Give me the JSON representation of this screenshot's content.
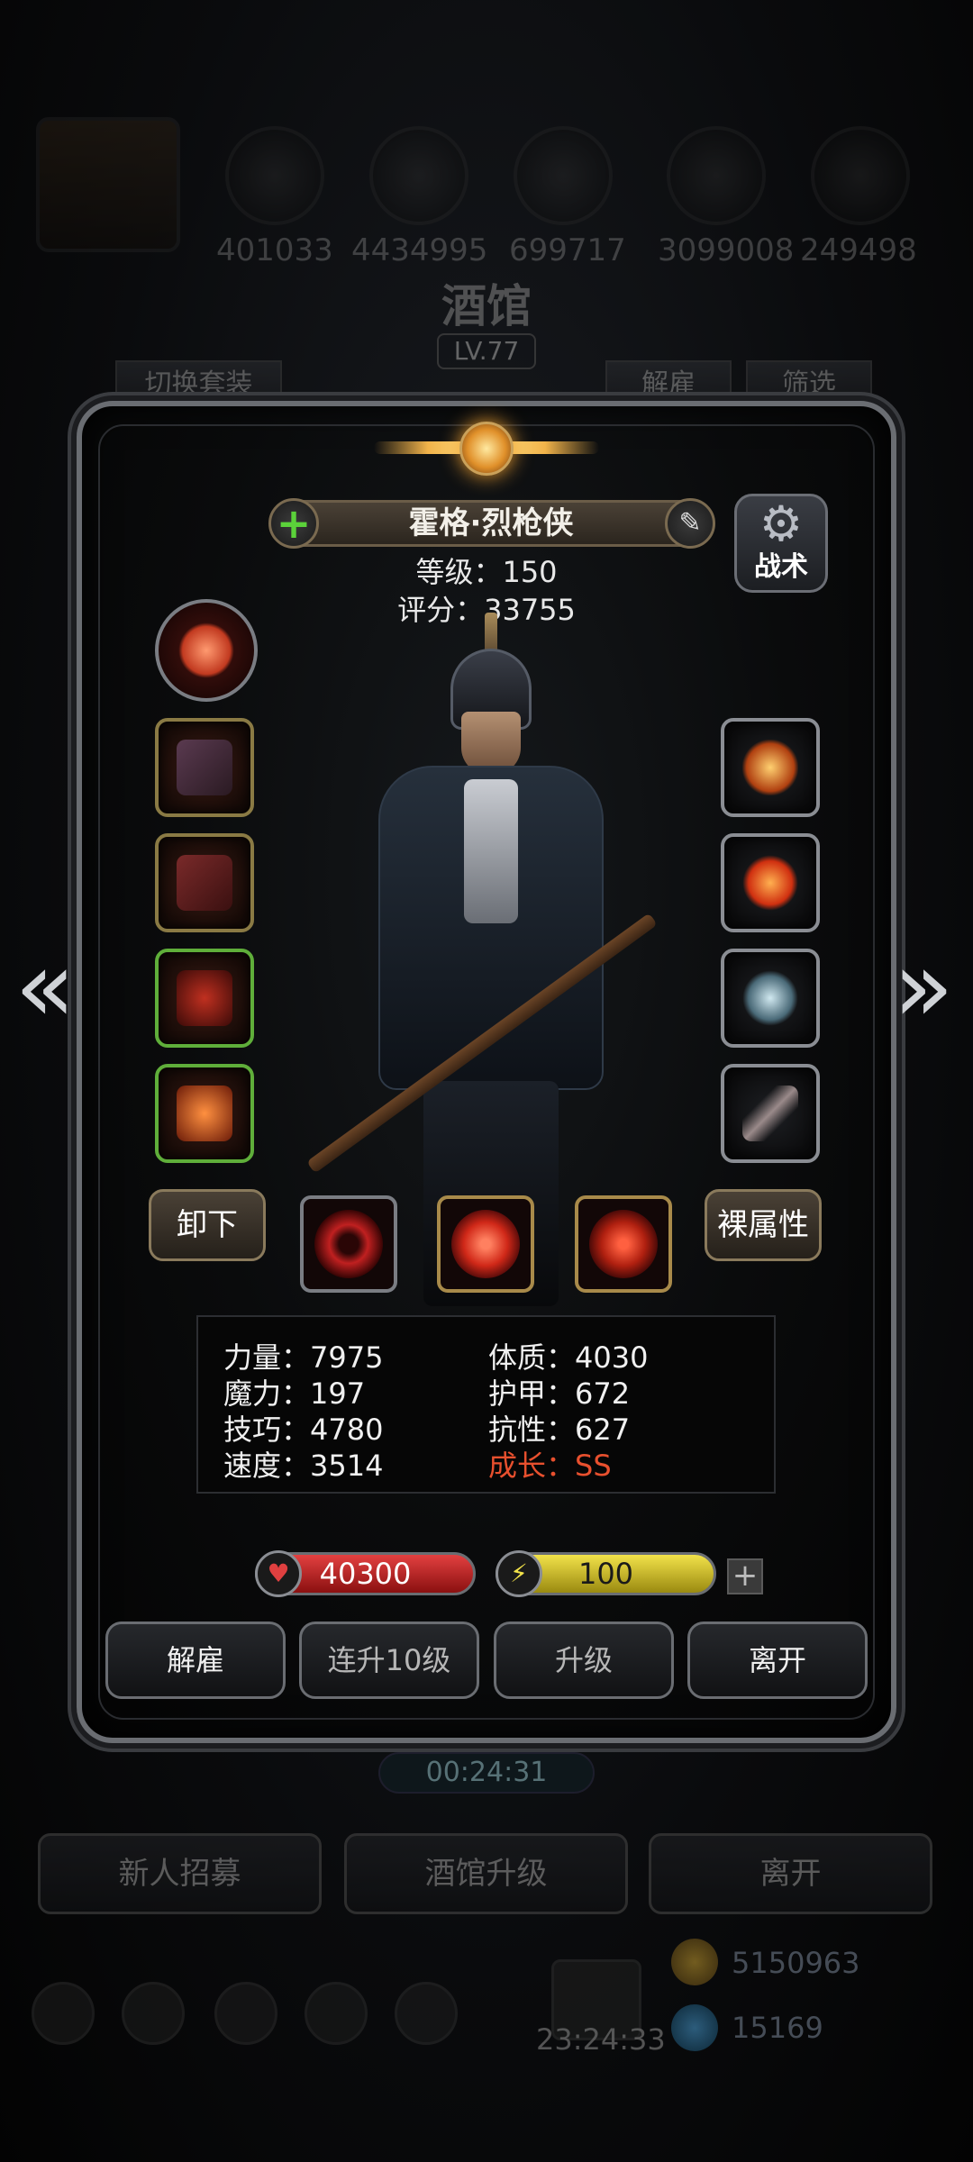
{
  "background": {
    "resources": [
      "401033",
      "4434995",
      "699717",
      "3099008",
      "249498"
    ],
    "title": "酒馆",
    "level": "LV.77",
    "switch_outfit": "切换套装",
    "dismiss_tab": "解雇",
    "filter_tab": "筛选",
    "timer": "00:24:31",
    "recruit": "新人招募",
    "upgrade_tavern": "酒馆升级",
    "leave": "离开",
    "dock_timer": "23:24:33",
    "gold": "5150963",
    "gems": "15169"
  },
  "hero": {
    "name": "霍格·烈枪侠",
    "level_label": "等级：150",
    "score_label": "评分：33755",
    "tactics": "战术",
    "unequip": "卸下",
    "bare_attr": "裸属性"
  },
  "equipment": {
    "left": [
      "pistol",
      "jacket",
      "demon-mask",
      "flame-gun"
    ],
    "right": [
      "fire-ring",
      "fire-orb",
      "crystal-emblem",
      "feather"
    ]
  },
  "skills": [
    "crosshair-skill",
    "vortex-skill",
    "target-skill"
  ],
  "stats": {
    "strength": "力量：7975",
    "magic": "魔力：197",
    "skill": "技巧：4780",
    "speed": "速度：3514",
    "constitution": "体质：4030",
    "armor": "护甲：672",
    "resistance": "抗性：627",
    "growth": "成长：SS"
  },
  "bars": {
    "hp": "40300",
    "energy": "100"
  },
  "actions": {
    "dismiss": "解雇",
    "level_up_10": "连升10级",
    "level_up": "升级",
    "leave": "离开"
  },
  "colors": {
    "growth": "#e8502e",
    "hp": "#d32f2f",
    "energy": "#e6d43a",
    "gold_accent": "#f1b34a"
  }
}
